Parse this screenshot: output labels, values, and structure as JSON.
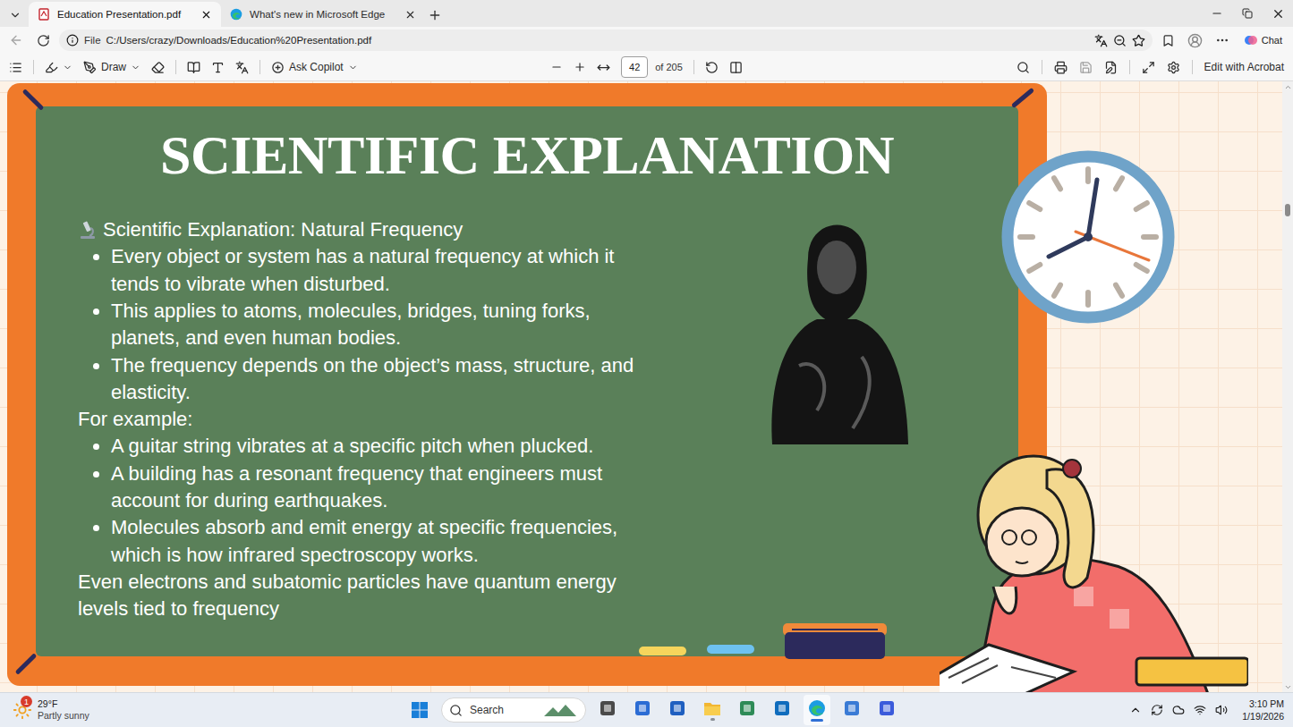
{
  "window": {
    "tabs": [
      {
        "label": "Education Presentation.pdf",
        "selected": true
      },
      {
        "label": "What's new in Microsoft Edge",
        "selected": false
      }
    ]
  },
  "address_bar": {
    "scheme": "File",
    "url": "C:/Users/crazy/Downloads/Education%20Presentation.pdf",
    "chat": "Chat"
  },
  "pdf_toolbar": {
    "draw": "Draw",
    "ask": "Ask Copilot",
    "page": "42",
    "total": "of 205",
    "edit": "Edit with Acrobat"
  },
  "slide": {
    "title": "SCIENTIFIC EXPLANATION",
    "heading": "Scientific Explanation: Natural Frequency",
    "points": [
      "Every object or system has a natural frequency at which it tends to vibrate when disturbed.",
      "This applies to atoms, molecules, bridges, tuning forks, planets, and even human bodies.",
      "The frequency depends on the object’s mass, structure, and elasticity."
    ],
    "example_label": "For example:",
    "examples": [
      "A guitar string vibrates at a specific pitch when plucked.",
      "A building has a resonant frequency that engineers must account for during earthquakes.",
      "Molecules absorb and emit energy at specific frequencies, which is how infrared spectroscopy works."
    ],
    "closing": "Even electrons and subatomic particles have quantum energy levels tied to frequency"
  },
  "scrollbar": {
    "level": 0.2
  },
  "taskbar": {
    "weather": {
      "temp": "29°F",
      "condition": "Partly sunny",
      "badge": "1"
    },
    "search": "Search",
    "apps": [
      {
        "running": false,
        "selected": false
      },
      {
        "running": false,
        "selected": false
      },
      {
        "running": false,
        "selected": false
      },
      {
        "running": true,
        "selected": false
      },
      {
        "running": false,
        "selected": false
      },
      {
        "running": false,
        "selected": false
      },
      {
        "running": true,
        "selected": true
      },
      {
        "running": false,
        "selected": false
      },
      {
        "running": false,
        "selected": false
      }
    ],
    "time": "3:10 PM",
    "date": "1/19/2026"
  }
}
